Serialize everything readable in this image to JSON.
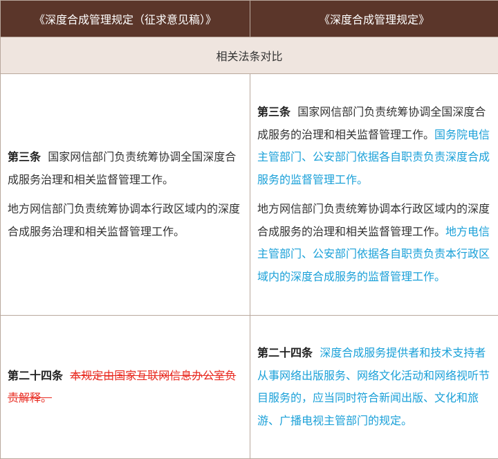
{
  "headers": {
    "left": "《深度合成管理规定（征求意见稿）》",
    "right": "《深度合成管理规定》"
  },
  "section_title": "相关法条对比",
  "rows": [
    {
      "left": {
        "paragraphs": [
          {
            "article": "第三条",
            "text": "国家网信部门负责统筹协调全国深度合成服务治理和相关监督管理工作。"
          },
          {
            "text": "地方网信部门负责统筹协调本行政区域内的深度合成服务治理和相关监督管理工作。"
          }
        ]
      },
      "right": {
        "paragraphs": [
          {
            "article": "第三条",
            "text": "国家网信部门负责统筹协调全国深度合成服务的治理和相关监督管理工作。",
            "highlight": "国务院电信主管部门、公安部门依据各自职责负责深度合成服务的监督管理工作。"
          },
          {
            "text": "地方网信部门负责统筹协调本行政区域内的深度合成服务的治理和相关监督管理工作。",
            "highlight": "地方电信主管部门、公安部门依据各自职责负责本行政区域内的深度合成服务的监督管理工作。"
          }
        ]
      }
    },
    {
      "left": {
        "article": "第二十四条",
        "deleted": "本规定由国家互联网信息办公室负责解释。"
      },
      "right": {
        "article": "第二十四条",
        "highlight": "深度合成服务提供者和技术支持者从事网络出版服务、网络文化活动和网络视听节目服务的，应当同时符合新闻出版、文化和旅游、广播电视主管部门的规定。"
      }
    }
  ],
  "colors": {
    "header_bg": "#5b362a",
    "section_bg": "#efe5df",
    "border": "#b9a89d",
    "added_text": "#1aa0d8",
    "deleted_text": "#e8281e"
  }
}
